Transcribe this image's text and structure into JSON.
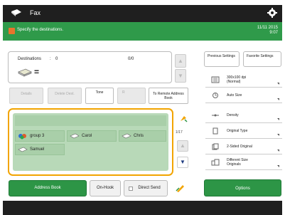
{
  "titlebar": {
    "title": "Fax"
  },
  "status": {
    "message": "Specify the destinations.",
    "date": "11/11 2015",
    "time": "9:07"
  },
  "destinations": {
    "label": "Destinations",
    "colon": ":",
    "count": "0",
    "max": "0/0"
  },
  "buttons": {
    "details": "Details",
    "delete_dest": "Delete Dest.",
    "tone": "Tone",
    "r": "R",
    "to_remote": "To Remote Address Book"
  },
  "address_list": {
    "entries": [
      "group 3",
      "Carol",
      "Chris",
      "Samuel"
    ],
    "page": "1/17"
  },
  "bottom": {
    "address_book": "Address Book",
    "on_hook": "On-Hook",
    "direct_send": "Direct Send",
    "options": "Options"
  },
  "right_panel": {
    "previous_settings": "Previous Settings",
    "favorite_settings": "Favorite Settings",
    "settings": [
      {
        "icon": "resolution-icon",
        "line1": "300x100 dpi",
        "line2": "(Normal)"
      },
      {
        "icon": "auto-size-icon",
        "line1": "Auto Size",
        "line2": ""
      },
      {
        "icon": "density-icon",
        "line1": "Density",
        "line2": ""
      },
      {
        "icon": "original-type-icon",
        "line1": "Original Type",
        "line2": ""
      },
      {
        "icon": "two-sided-icon",
        "line1": "2-Sided Original",
        "line2": ""
      },
      {
        "icon": "different-size-icon",
        "line1": "Different Size",
        "line2": "Originals"
      }
    ]
  },
  "colors": {
    "accent_green": "#2d9546",
    "status_green": "#2f9a4a",
    "highlight_orange": "#f2a400"
  }
}
